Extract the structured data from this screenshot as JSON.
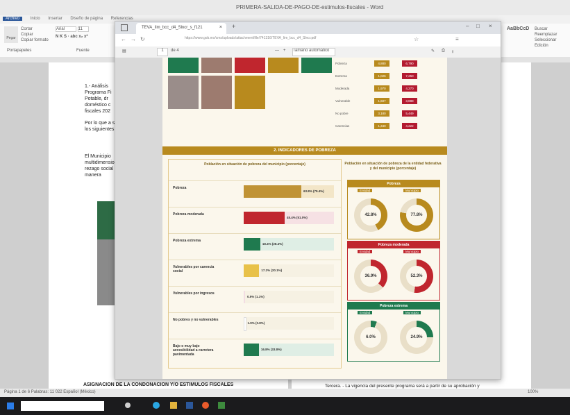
{
  "word": {
    "title": "PRIMERA-SALIDA-DE-PAGO-DE-estimulos-fiscales - Word",
    "tabs": [
      "Archivo",
      "Inicio",
      "Insertar",
      "Diseño de página",
      "Referencias"
    ],
    "active_tab": "Inicio",
    "ribbon": {
      "paste": "Pegar",
      "cut": "Cortar",
      "copy": "Copiar",
      "format_painter": "Copiar formato",
      "clipboard": "Portapapeles",
      "font": "Fuente",
      "font_name": "Arial",
      "font_size": "11",
      "style_label": "AaBbCcD",
      "find": "Buscar",
      "replace": "Reemplazar",
      "select": "Seleccionar",
      "edit": "Edición"
    },
    "left_text": [
      {
        "t": "1.- Análisis",
        "b": false
      },
      {
        "t": "Programa Fi",
        "b": true
      },
      {
        "t": "Potable, dr",
        "b": true
      },
      {
        "t": "doméstico c",
        "b": true
      },
      {
        "t": "fiscales 202",
        "b": true
      },
      {
        "t": "Por lo que a s",
        "b": false
      },
      {
        "t": "los siguientes",
        "b": false
      },
      {
        "t": "El  Municipio",
        "b": false
      },
      {
        "t": "multidimensio",
        "b": false
      },
      {
        "t": "rezago social",
        "b": false
      },
      {
        "t": "manera",
        "b": false
      }
    ],
    "heading_bottom": "ASIGNACION DE LA CONDONACION Y/O ESTIMULOS FISCALES",
    "right_bottom": "Tercera. - La vigencia del presente programa será a partir de su aprobación y",
    "status": "Página 1 de 6   Palabras: 11 022   Español (México)",
    "zoom": "100%"
  },
  "browser": {
    "tab_title": "TEVA_Iim_bcc_d4_Slncr_s_f121",
    "url": "https://www.gob.mx/cms/uploads/attachment/file/741316/TEVA_Iim_bcc_d4_Slncr.pdf",
    "page_field": "1",
    "page_total": "de 4",
    "zoom_option": "Tamaño automático"
  },
  "pdf": {
    "section_title": "2. INDICADORES DE POBREZA",
    "left_chart_title": "Población en situación de pobreza del municipio (porcentaje)",
    "right_chart_title": "Población en situación de pobreza de la entidad federativa y del municipio (porcentaje)",
    "table_rows": [
      {
        "label": "Pobreza",
        "a": "4,880",
        "b": "6,790",
        "ca": "#b88a1e",
        "cb": "#b31b30"
      },
      {
        "label": "Extrema",
        "a": "1,026",
        "b": "7,250",
        "ca": "#b88a1e",
        "cb": "#b31b30"
      },
      {
        "label": "Moderada",
        "a": "1,970",
        "b": "4,270",
        "ca": "#b88a1e",
        "cb": "#b31b30"
      },
      {
        "label": "Vulnerable",
        "a": "1,607",
        "b": "3,888",
        "ca": "#b88a1e",
        "cb": "#b31b30"
      },
      {
        "label": "No pobre",
        "a": "3,180",
        "b": "5,449",
        "ca": "#b88a1e",
        "cb": "#b31b30"
      },
      {
        "label": "Carencias",
        "a": "1,340",
        "b": "4,222",
        "ca": "#b88a1e",
        "cb": "#b31b30"
      }
    ]
  },
  "chart_data": [
    {
      "type": "bar",
      "title": "Población en situación de pobreza del municipio (porcentaje)",
      "categories": [
        "Pobreza",
        "Pobreza moderada",
        "Pobreza extrema",
        "Vulnerables por carencia social",
        "Vulnerables por ingresos",
        "No pobres y no vulnerables",
        "Bajo o muy bajo accesibilidad a carretera pavimentada"
      ],
      "values": [
        63.8,
        45.4,
        18.4,
        17.2,
        0.5,
        1.9,
        16.8
      ],
      "value_labels": [
        "63.8% (79.4%)",
        "45.4% (51.0%)",
        "18.4% (28.4%)",
        "17.2% (20.1%)",
        "0.5% (1.1%)",
        "1.9% (0.8%)",
        "16.8% (33.8%)"
      ],
      "colors": [
        "#c09335",
        "#c0262e",
        "#1f7a4f",
        "#e8c149",
        "#f3dde3",
        "#ffffff",
        "#1f7a4f"
      ],
      "ylim": [
        0,
        100
      ]
    },
    {
      "type": "pie",
      "groups": [
        {
          "title": "Pobreza",
          "labels": [
            "Entidad",
            "Municipio"
          ],
          "values": [
            42.8,
            77.8
          ],
          "color": "#b88a1e"
        },
        {
          "title": "Pobreza moderada",
          "labels": [
            "Entidad",
            "Municipio"
          ],
          "values": [
            36.9,
            52.3
          ],
          "color": "#c0262e"
        },
        {
          "title": "Pobreza extrema",
          "labels": [
            "Entidad",
            "Municipio"
          ],
          "values": [
            6.0,
            24.9
          ],
          "color": "#1f7a4f"
        }
      ]
    }
  ],
  "colors": {
    "gold": "#b88a1e",
    "red": "#c0262e",
    "green": "#1f7a4f",
    "word_blue": "#2b579a"
  }
}
